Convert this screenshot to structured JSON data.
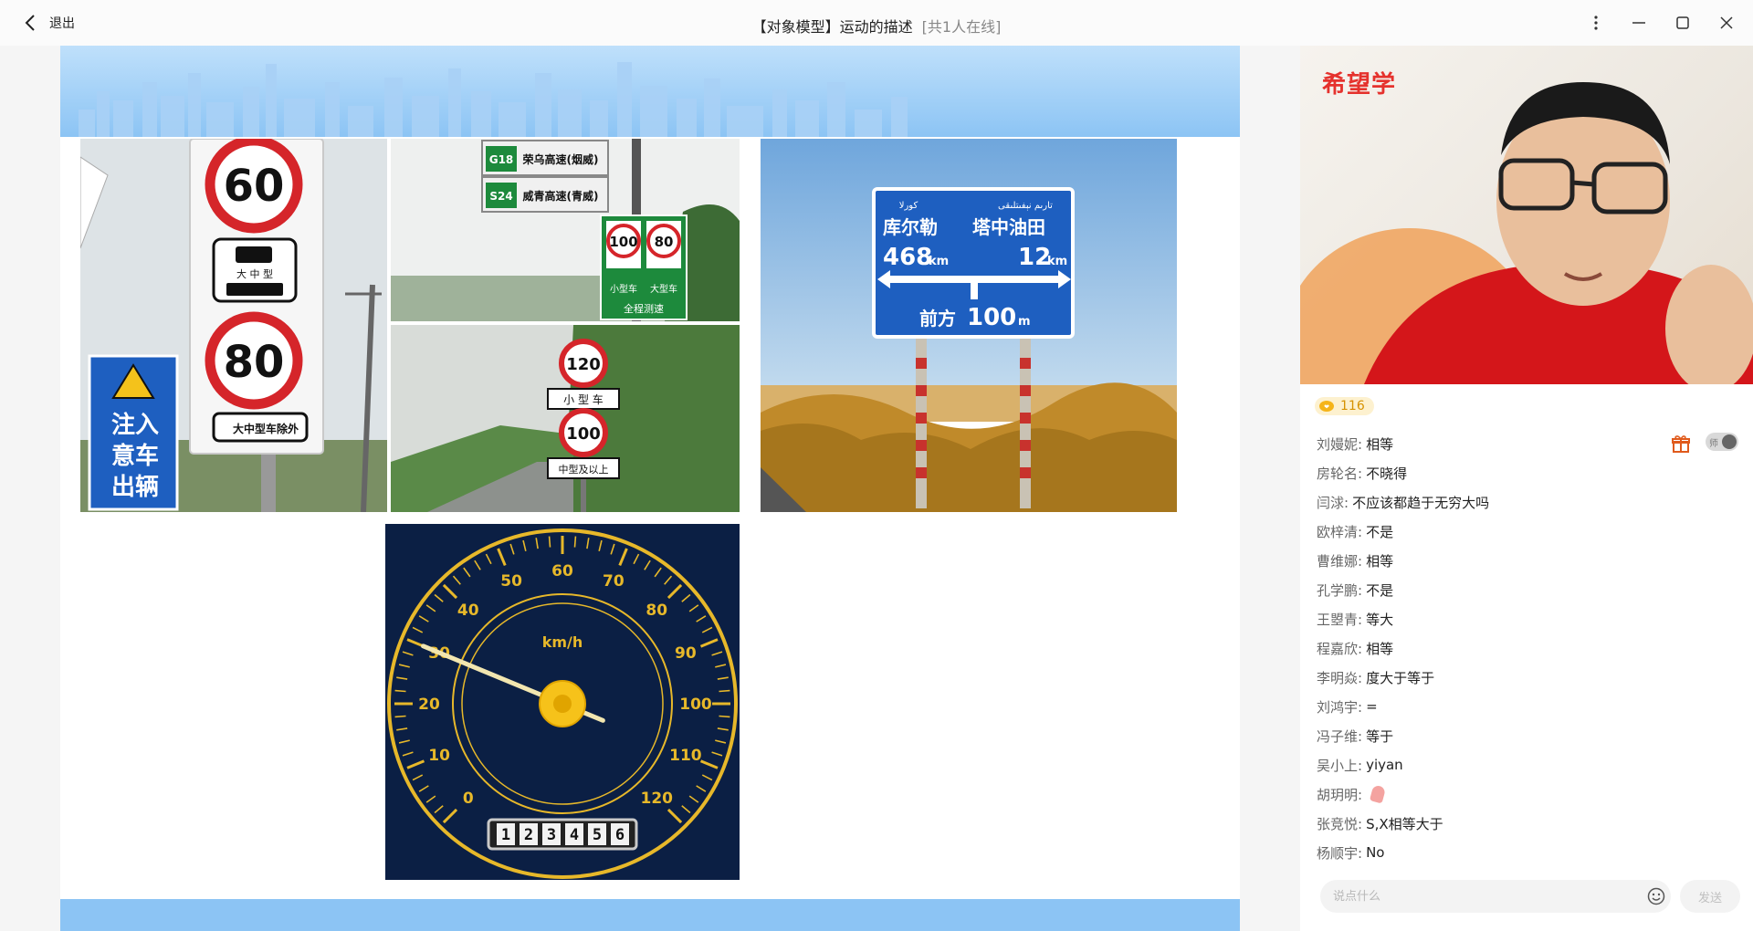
{
  "header": {
    "back_label": "退出",
    "title": "【对象模型】运动的描述",
    "online": "[共1人在线]"
  },
  "slide": {
    "sign_left": {
      "limit_top": "60",
      "type_top": "大 中 型",
      "limit_bottom": "80",
      "type_bottom": "大中型车除外",
      "warning": [
        "注入",
        "意车",
        "出辆"
      ]
    },
    "sign_highway": {
      "route_1_code": "G18",
      "route_1_name": "荣乌高速(烟威)",
      "route_2_code": "S24",
      "route_2_name": "威青高速(青威)",
      "limit_1": "100",
      "limit_2": "80",
      "lane_1": "小型车",
      "lane_2": "大型车",
      "note": "全程测速"
    },
    "sign_lane": {
      "limit_top": "120",
      "type_top": "小 型 车",
      "limit_bottom": "100",
      "type_bottom": "中型及以上"
    },
    "sign_distance": {
      "uyghur_left": "كورلا",
      "uyghur_right": "تارىم نېفىتلىقى",
      "dest_left": "库尔勒",
      "dist_left": "468",
      "dest_right": "塔中油田",
      "dist_right": "12",
      "unit": "km",
      "ahead": "前方",
      "ahead_dist": "100",
      "ahead_unit": "m"
    },
    "speedometer": {
      "unit": "km/h",
      "ticks": [
        "0",
        "10",
        "20",
        "30",
        "40",
        "50",
        "60",
        "70",
        "80",
        "90",
        "100",
        "110",
        "120"
      ],
      "odometer": [
        "1",
        "2",
        "3",
        "4",
        "5",
        "6"
      ],
      "needle_value": 30
    }
  },
  "panel": {
    "brand": "希望学",
    "like_count": "116",
    "teacher_label": "师",
    "chat": [
      {
        "name": "刘嫚妮:",
        "message": "相等"
      },
      {
        "name": "房轮名:",
        "message": "不晓得"
      },
      {
        "name": "闫浗:",
        "message": "不应该都趋于无穷大吗"
      },
      {
        "name": "欧梓清:",
        "message": "不是"
      },
      {
        "name": "曹维娜:",
        "message": "相等"
      },
      {
        "name": "孔学鹏:",
        "message": "不是"
      },
      {
        "name": "王曌青:",
        "message": "等大"
      },
      {
        "name": "程嘉欣:",
        "message": "相等"
      },
      {
        "name": "李明焱:",
        "message": "度大于等于"
      },
      {
        "name": "刘鸿宇:",
        "message": "="
      },
      {
        "name": "冯子维:",
        "message": "等于"
      },
      {
        "name": "吴小上:",
        "message": "yiyan"
      },
      {
        "name": "胡玥明:",
        "message": ""
      },
      {
        "name": "张竞悦:",
        "message": "S,X相等大于"
      },
      {
        "name": "杨顺宇:",
        "message": "No"
      }
    ],
    "input_placeholder": "说点什么",
    "send_label": "发送"
  },
  "colors": {
    "sign_blue": "#1e5fc0",
    "sign_red": "#d5252a",
    "dial_bg": "#0b1f44",
    "dial_gold": "#e7b82a",
    "brand_red": "#e5322d",
    "shirt_red": "#d4161a"
  },
  "icons": [
    "chevron-left-icon",
    "more-vertical-icon",
    "minimize-icon",
    "maximize-icon",
    "close-icon",
    "gift-icon",
    "emoji-icon",
    "like-icon"
  ]
}
